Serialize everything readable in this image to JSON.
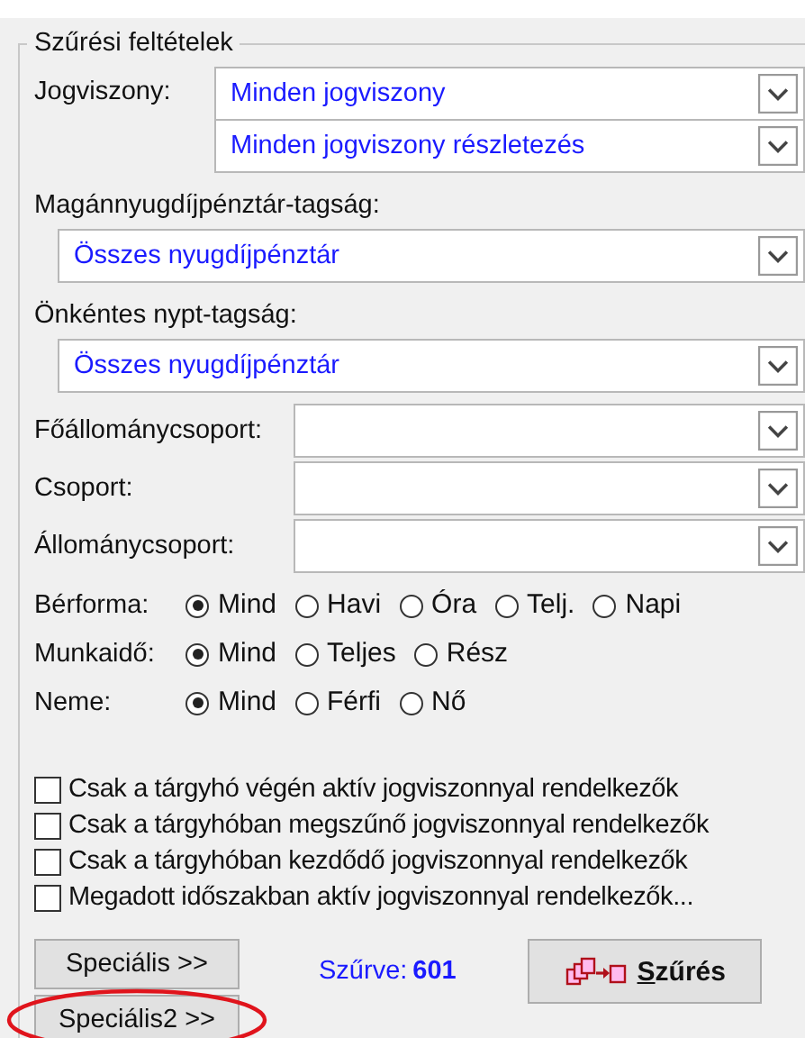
{
  "group": {
    "title": "Szűrési feltételek"
  },
  "jogviszony": {
    "label": "Jogviszony:",
    "combos": [
      {
        "value": "Minden jogviszony"
      },
      {
        "value": "Minden jogviszony részletezés"
      }
    ]
  },
  "fund_fields": [
    {
      "label": "Magánnyugdíjpénztár-tagság:",
      "value": "Összes nyugdíjpénztár"
    },
    {
      "label": "Önkéntes nypt-tagság:",
      "value": "Összes nyugdíjpénztár"
    }
  ],
  "group_fields": [
    {
      "label": "Főállománycsoport:"
    },
    {
      "label": "Csoport:"
    },
    {
      "label": "Állománycsoport:"
    }
  ],
  "radio_groups": [
    {
      "label": "Bérforma:",
      "options": [
        {
          "label": "Mind",
          "selected": true
        },
        {
          "label": "Havi",
          "selected": false
        },
        {
          "label": "Óra",
          "selected": false
        },
        {
          "label": "Telj.",
          "selected": false
        },
        {
          "label": "Napi",
          "selected": false
        }
      ]
    },
    {
      "label": "Munkaidő:",
      "options": [
        {
          "label": "Mind",
          "selected": true
        },
        {
          "label": "Teljes",
          "selected": false
        },
        {
          "label": "Rész",
          "selected": false
        }
      ]
    },
    {
      "label": "Neme:",
      "options": [
        {
          "label": "Mind",
          "selected": true
        },
        {
          "label": "Férfi",
          "selected": false
        },
        {
          "label": "Nő",
          "selected": false
        }
      ]
    }
  ],
  "checkboxes": [
    {
      "label": "Csak a tárgyhó végén aktív jogviszonnyal rendelkezők",
      "checked": false
    },
    {
      "label": "Csak a tárgyhóban megszűnő jogviszonnyal rendelkezők",
      "checked": false
    },
    {
      "label": "Csak a tárgyhóban kezdődő jogviszonnyal rendelkezők",
      "checked": false
    },
    {
      "label": "Megadott időszakban aktív jogviszonnyal rendelkezők...",
      "checked": false
    }
  ],
  "special_buttons": [
    {
      "label": "Speciális >>",
      "circled": false
    },
    {
      "label": "Speciális2 >>",
      "circled": true
    }
  ],
  "filtered": {
    "label": "Szűrve:",
    "value": "601"
  },
  "filter_button": {
    "label": "Szűrés"
  }
}
